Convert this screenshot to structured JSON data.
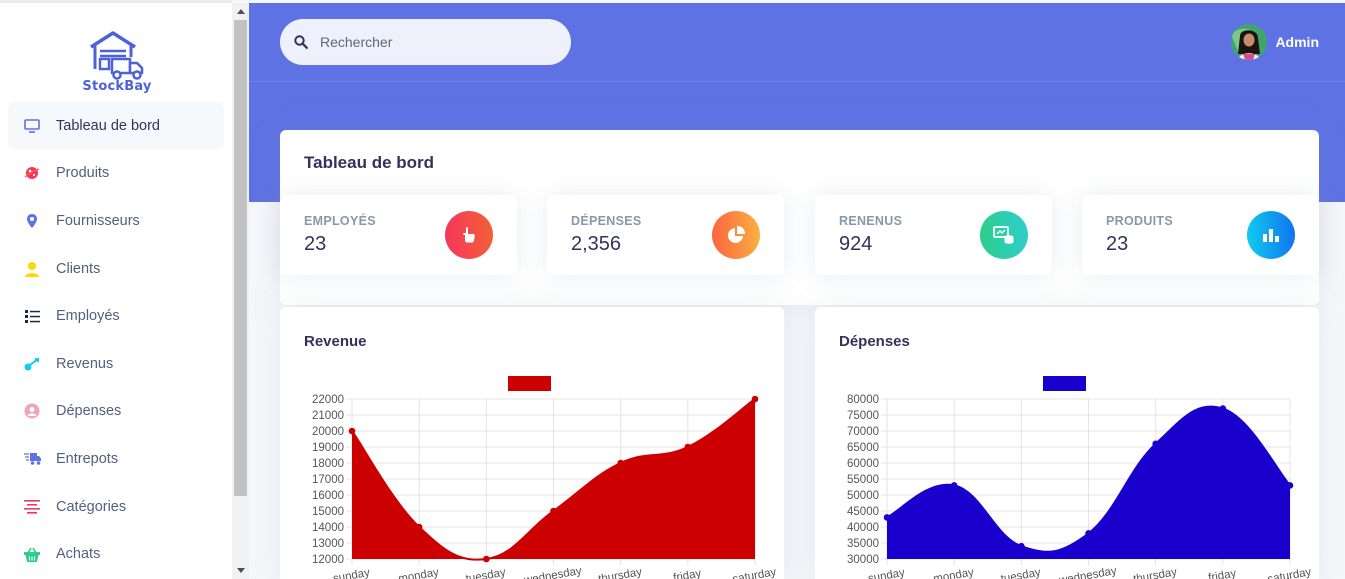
{
  "brand": {
    "name": "StockBay"
  },
  "search": {
    "placeholder": "Rechercher"
  },
  "user": {
    "name": "Admin"
  },
  "sidebar": {
    "items": [
      {
        "label": "Tableau de bord",
        "icon": "monitor-icon",
        "color": "#5e72e4",
        "active": true
      },
      {
        "label": "Produits",
        "icon": "planet-icon",
        "color": "#f5365c"
      },
      {
        "label": "Fournisseurs",
        "icon": "pin-icon",
        "color": "#5e72e4"
      },
      {
        "label": "Clients",
        "icon": "user-icon",
        "color": "#ffd600"
      },
      {
        "label": "Employés",
        "icon": "list-icon",
        "color": "#172b4d"
      },
      {
        "label": "Revenus",
        "icon": "key-icon",
        "color": "#11cdef"
      },
      {
        "label": "Dépenses",
        "icon": "circle-user-icon",
        "color": "#f3a4b5"
      },
      {
        "label": "Entrepots",
        "icon": "truck-icon",
        "color": "#5e72e4"
      },
      {
        "label": "Catégories",
        "icon": "align-icon",
        "color": "#f5365c"
      },
      {
        "label": "Achats",
        "icon": "basket-icon",
        "color": "#2dce89"
      }
    ]
  },
  "dashboard": {
    "title": "Tableau de bord",
    "stats": [
      {
        "label": "EMPLOYÉS",
        "value": "23",
        "icon": "hand-icon",
        "gradient": [
          "#f5365c",
          "#f56036"
        ]
      },
      {
        "label": "DÉPENSES",
        "value": "2,356",
        "icon": "pie-icon",
        "gradient": [
          "#fb6340",
          "#fbb140"
        ]
      },
      {
        "label": "RENENUS",
        "value": "924",
        "icon": "money-icon",
        "gradient": [
          "#2dce89",
          "#2dcecc"
        ]
      },
      {
        "label": "PRODUITS",
        "value": "23",
        "icon": "bar-chart-icon",
        "gradient": [
          "#11cdef",
          "#1171ef"
        ]
      }
    ]
  },
  "charts": {
    "revenue": {
      "title": "Revenue"
    },
    "expenses": {
      "title": "Dépenses"
    }
  },
  "chart_data": [
    {
      "type": "area",
      "title": "Revenue",
      "categories": [
        "sunday",
        "monday",
        "tuesday",
        "wednesday",
        "thursday",
        "friday",
        "saturday"
      ],
      "values": [
        20000,
        14000,
        12000,
        15000,
        18000,
        19000,
        22000
      ],
      "ylim": [
        12000,
        22000
      ],
      "yticks": [
        22000,
        21000,
        20000,
        19000,
        18000,
        17000,
        16000,
        15000,
        14000,
        13000,
        12000
      ],
      "color": "#cc0000",
      "grid": true,
      "legend": "top"
    },
    {
      "type": "area",
      "title": "Dépenses",
      "categories": [
        "sunday",
        "monday",
        "tuesday",
        "wednesday",
        "thursday",
        "friday",
        "saturday"
      ],
      "values": [
        43000,
        53000,
        34000,
        38000,
        66000,
        77000,
        53000
      ],
      "ylim": [
        30000,
        80000
      ],
      "yticks": [
        80000,
        75000,
        70000,
        65000,
        60000,
        55000,
        50000,
        45000,
        40000,
        35000,
        30000
      ],
      "color": "#1a00cc",
      "grid": true,
      "legend": "top"
    }
  ]
}
